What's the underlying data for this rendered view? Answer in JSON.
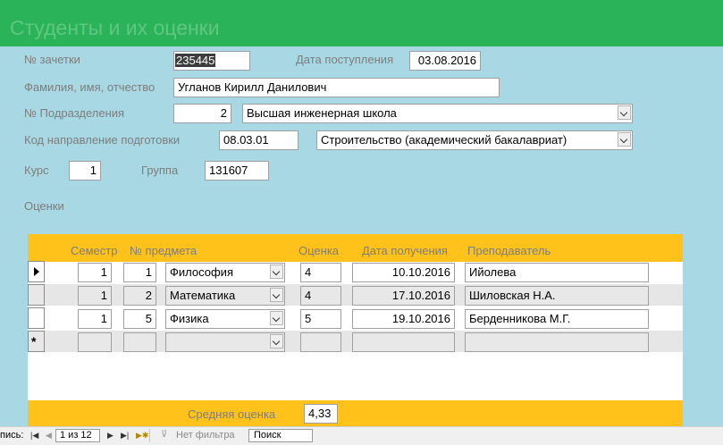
{
  "form": {
    "title": "Студенты и их оценки",
    "fields": {
      "record_book_label": "№ зачетки",
      "record_book_value": "235445",
      "admission_date_label": "Дата поступления",
      "admission_date_value": "03.08.2016",
      "full_name_label": "Фамилия, имя, отчество",
      "full_name_value": "Угланов Кирилл Данилович",
      "department_label": "№  Подразделения",
      "department_number": "2",
      "department_name": "Высшая инженерная школа",
      "direction_label": "Код направление подготовки",
      "direction_code": "08.03.01",
      "direction_name": "Строительство (академический бакалавриат)",
      "course_label": "Курс",
      "course_value": "1",
      "group_label": "Группа",
      "group_value": "131607"
    },
    "grades_label": "Оценки"
  },
  "grades": {
    "columns": [
      "Семестр",
      "№ предмета",
      "Оценка",
      "Дата получения",
      "Преподаватель"
    ],
    "rows": [
      {
        "semester": "1",
        "subject_no": "1",
        "subject": "Философия",
        "grade": "4",
        "date": "10.10.2016",
        "teacher": "Ийолева"
      },
      {
        "semester": "1",
        "subject_no": "2",
        "subject": "Математика",
        "grade": "4",
        "date": "17.10.2016",
        "teacher": "Шиловская Н.А."
      },
      {
        "semester": "1",
        "subject_no": "5",
        "subject": "Физика",
        "grade": "5",
        "date": "19.10.2016",
        "teacher": "Берденникова М.Г."
      }
    ],
    "average_label": "Средняя оценка",
    "average_value": "4,33"
  },
  "navigation": {
    "records_label": "пись:",
    "position": "1 из 12",
    "filter_label": "Нет фильтра",
    "search_placeholder": "Поиск"
  },
  "colors": {
    "header": "#2bb35a",
    "form_background": "#a8d8e4",
    "subform_band": "#ffc21a"
  }
}
